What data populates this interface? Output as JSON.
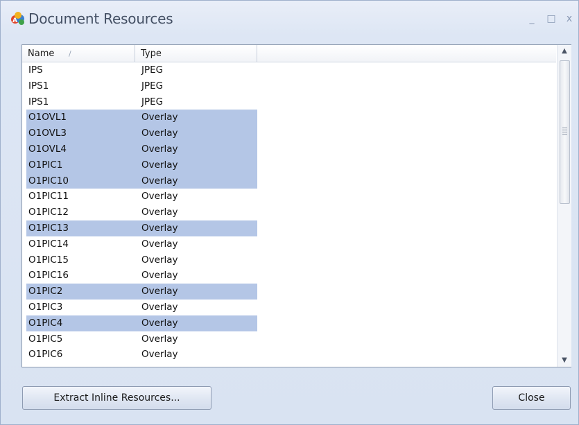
{
  "window": {
    "title": "Document Resources",
    "icon": "app-icon",
    "controls": {
      "minimize": "_",
      "maximize": "□",
      "close": "x"
    }
  },
  "list": {
    "columns": [
      {
        "label": "Name",
        "sorted": true
      },
      {
        "label": "Type"
      }
    ],
    "rows": [
      {
        "name": "IPS",
        "type": "JPEG",
        "selected": false
      },
      {
        "name": "IPS1",
        "type": "JPEG",
        "selected": false
      },
      {
        "name": "IPS1",
        "type": "JPEG",
        "selected": false
      },
      {
        "name": "O1OVL1",
        "type": "Overlay",
        "selected": true
      },
      {
        "name": "O1OVL3",
        "type": "Overlay",
        "selected": true
      },
      {
        "name": "O1OVL4",
        "type": "Overlay",
        "selected": true
      },
      {
        "name": "O1PIC1",
        "type": "Overlay",
        "selected": true
      },
      {
        "name": "O1PIC10",
        "type": "Overlay",
        "selected": true
      },
      {
        "name": "O1PIC11",
        "type": "Overlay",
        "selected": false
      },
      {
        "name": "O1PIC12",
        "type": "Overlay",
        "selected": false
      },
      {
        "name": "O1PIC13",
        "type": "Overlay",
        "selected": true
      },
      {
        "name": "O1PIC14",
        "type": "Overlay",
        "selected": false
      },
      {
        "name": "O1PIC15",
        "type": "Overlay",
        "selected": false
      },
      {
        "name": "O1PIC16",
        "type": "Overlay",
        "selected": false
      },
      {
        "name": "O1PIC2",
        "type": "Overlay",
        "selected": true
      },
      {
        "name": "O1PIC3",
        "type": "Overlay",
        "selected": false
      },
      {
        "name": "O1PIC4",
        "type": "Overlay",
        "selected": true
      },
      {
        "name": "O1PIC5",
        "type": "Overlay",
        "selected": false
      },
      {
        "name": "O1PIC6",
        "type": "Overlay",
        "selected": false
      }
    ]
  },
  "buttons": {
    "extract": "Extract Inline Resources...",
    "close": "Close"
  },
  "colors": {
    "selection": "#b4c6e6",
    "window_bg": "#dde6f4",
    "title_text": "#445064"
  }
}
